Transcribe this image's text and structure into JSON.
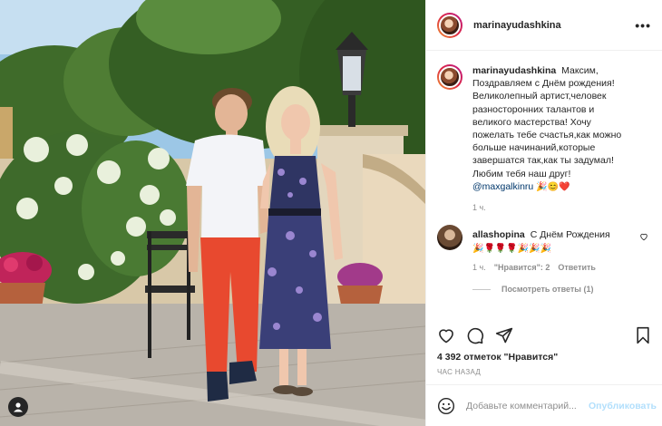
{
  "post": {
    "author": "marinayudashkina",
    "more_icon": "•••"
  },
  "caption": {
    "author": "marinayudashkina",
    "text": "Максим, Поздравляем с Днём рождения! Великолепный артист,человек разносторонних талантов и великого мастерства! Хочу пожелать тебе счастья,как можно больше начинаний,которые завершатся так,как ты задумал! Любим тебя наш друг!",
    "mention": "@maxgalkinru",
    "emojis": "🎉😊❤️",
    "time": "1 ч."
  },
  "comment": {
    "author": "allashopina",
    "text": "С Днём Рождения",
    "emojis": "🎉🌹🌹🌹🎉🎉🎉",
    "time": "1 ч.",
    "likes": "\"Нравится\": 2",
    "reply": "Ответить"
  },
  "replies_label": "Посмотреть ответы (1)",
  "likes_label": "4 392 отметок \"Нравится\"",
  "date_label": "ЧАС НАЗАД",
  "add_comment": {
    "placeholder": "Добавьте комментарий...",
    "post_label": "Опубликовать"
  },
  "colors": {
    "accent": "#0095f6",
    "post_disabled": "#b2dffc",
    "text": "#262626",
    "muted": "#8e8e8e"
  },
  "icons": [
    "heart-icon",
    "comment-icon",
    "share-icon",
    "bookmark-icon",
    "smile-icon",
    "user-tag-icon"
  ]
}
